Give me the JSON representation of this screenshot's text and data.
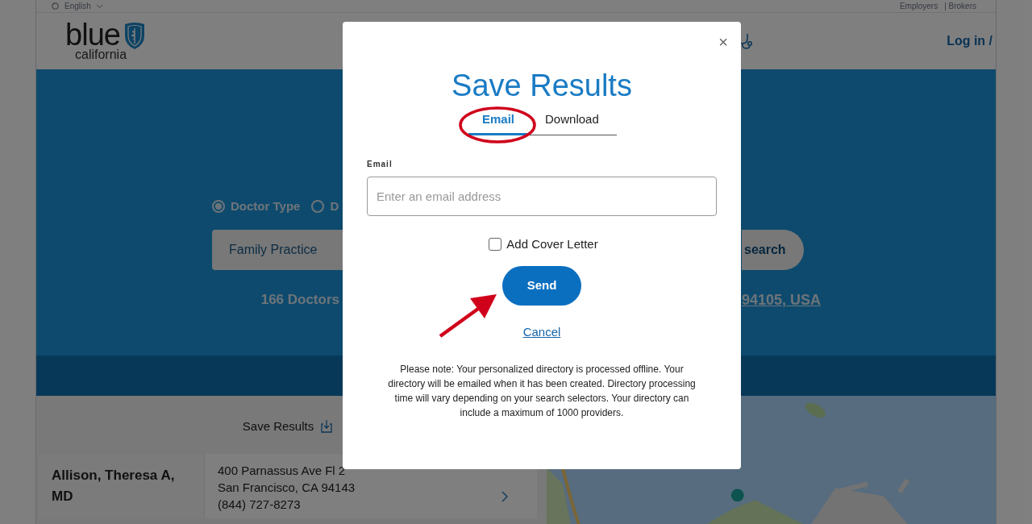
{
  "top_bar": {
    "language": "English",
    "links": [
      "Employers",
      "| Brokers"
    ]
  },
  "header": {
    "logo_word": "blue",
    "logo_sub": "california",
    "login": "Log in /"
  },
  "search": {
    "radios": [
      {
        "label": "Doctor Type",
        "selected": true
      },
      {
        "label": "D",
        "selected": false
      }
    ],
    "field_value": "Family Practice",
    "button": "search",
    "count": "166 Doctors",
    "location": "94105, USA"
  },
  "results": {
    "save_label": "Save Results",
    "rows": [
      {
        "name": "Allison, Theresa A, MD",
        "address": [
          "400 Parnassus Ave Fl 2",
          "San Francisco, CA 94143",
          "(844) 727-8273"
        ]
      }
    ]
  },
  "modal": {
    "close": "×",
    "title": "Save Results",
    "tabs": [
      {
        "label": "Email",
        "selected": true
      },
      {
        "label": "Download",
        "selected": false
      }
    ],
    "field_label": "Email",
    "placeholder": "Enter an email address",
    "checkbox": {
      "label": "Add Cover Letter",
      "checked": false
    },
    "send": "Send",
    "cancel": "Cancel",
    "note": "Please note: Your personalized directory is processed offline. Your directory will be emailed when it has been created. Directory processing time will vary depending on your search selectors. Your directory can include a maximum of 1000 providers."
  }
}
